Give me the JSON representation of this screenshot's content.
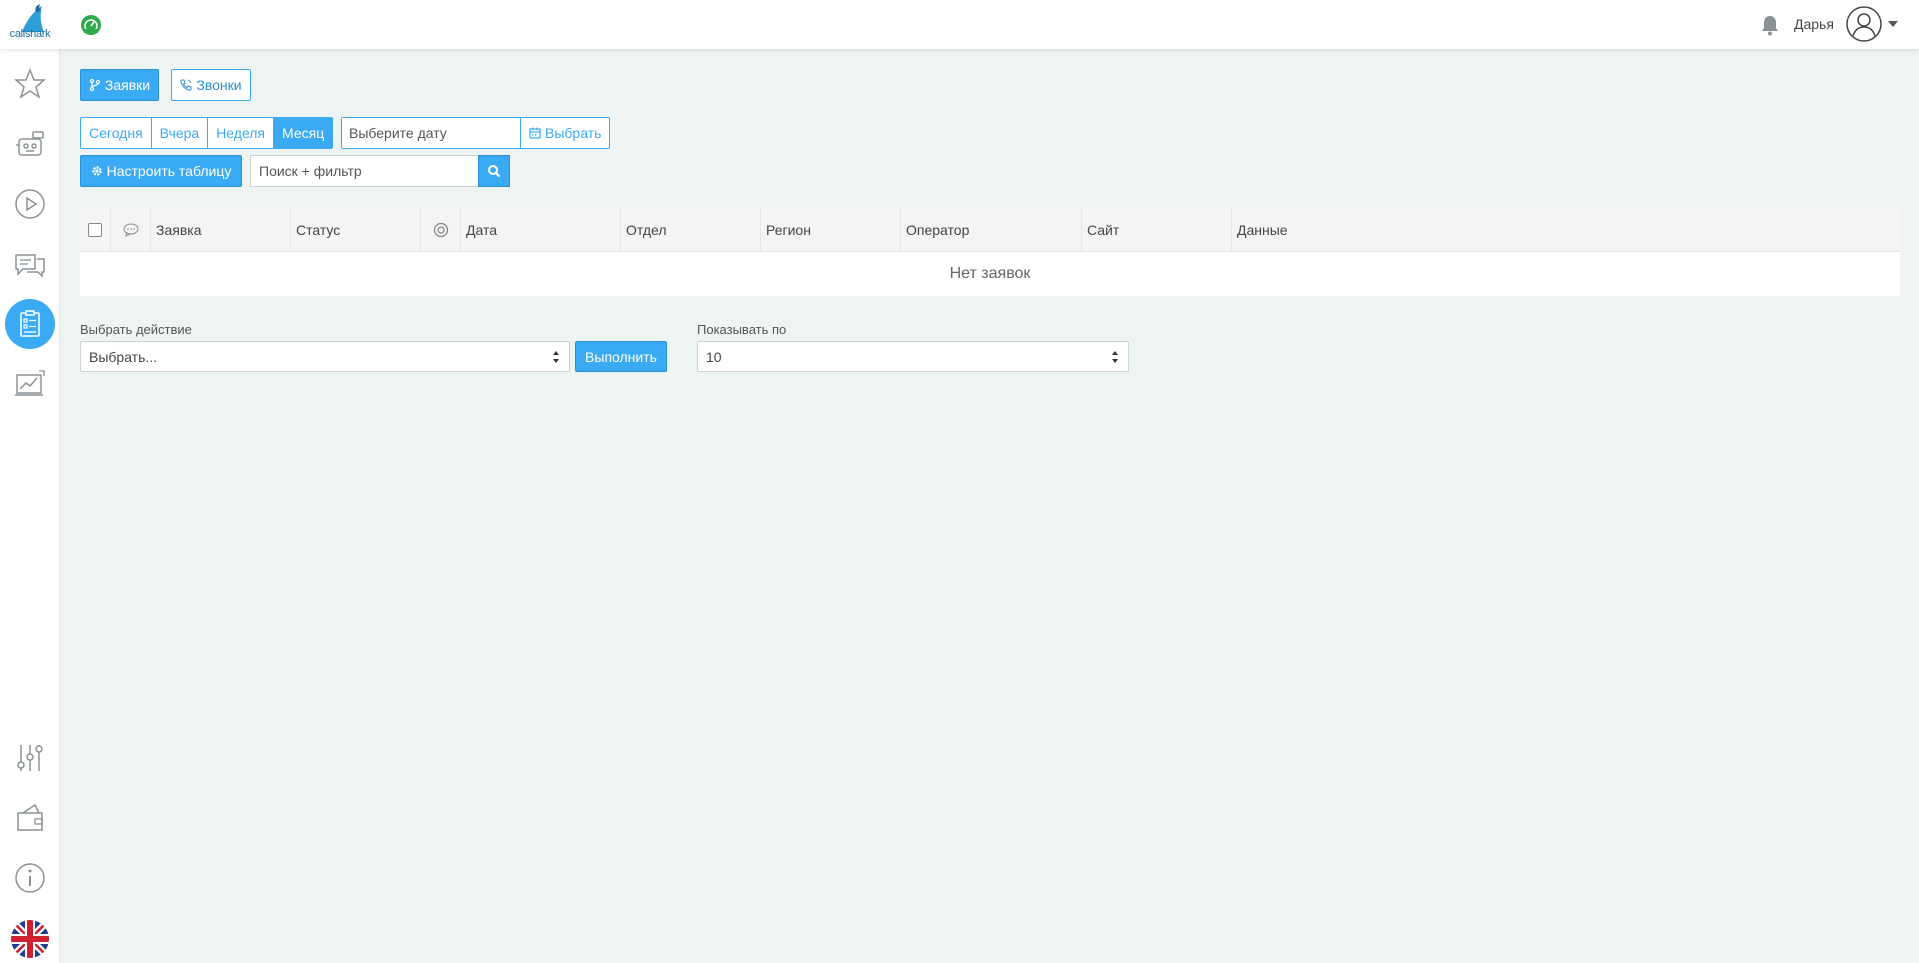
{
  "header": {
    "logo_text": "callshark",
    "user_name": "Дарья"
  },
  "sidebar": {
    "items": [
      "favorites",
      "robot",
      "play",
      "chat",
      "requests",
      "analytics",
      "settings",
      "wallet",
      "info",
      "language-en"
    ]
  },
  "toolbar": {
    "requests_label": "Заявки",
    "calls_label": "Звонки",
    "periods": [
      "Сегодня",
      "Вчера",
      "Неделя",
      "Месяц"
    ],
    "active_period": "Месяц",
    "date_placeholder": "Выберите дату",
    "pick_label": "Выбрать",
    "configure_table_label": "Настроить таблицу",
    "search_placeholder": "Поиск + фильтр"
  },
  "table": {
    "columns": [
      "Заявка",
      "Статус",
      "Дата",
      "Отдел",
      "Регион",
      "Оператор",
      "Сайт",
      "Данные"
    ],
    "empty_text": "Нет заявок"
  },
  "actions": {
    "label": "Выбрать действие",
    "select_value": "Выбрать...",
    "execute_label": "Выполнить",
    "page_size_label": "Показывать по",
    "page_size_value": "10"
  },
  "colors": {
    "accent": "#3aaaf5",
    "background": "#eef4f4",
    "dashboard_icon": "#2eaa4b"
  }
}
